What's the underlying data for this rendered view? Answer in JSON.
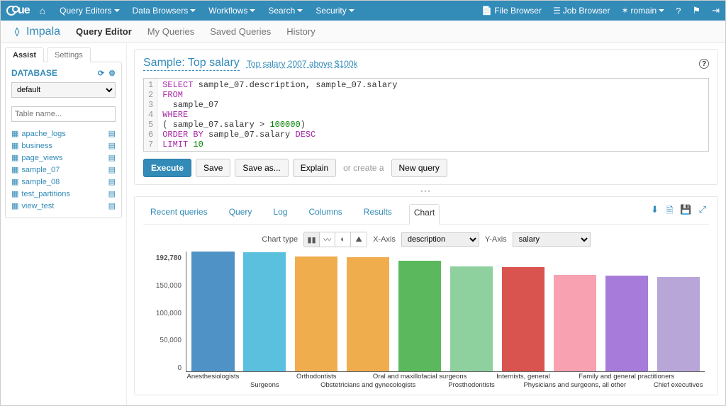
{
  "topnav": {
    "menus": [
      "Query Editors",
      "Data Browsers",
      "Workflows",
      "Search",
      "Security"
    ],
    "file_browser": "File Browser",
    "job_browser": "Job Browser",
    "user": "romain"
  },
  "subnav": {
    "brand": "Impala",
    "tabs": [
      "Query Editor",
      "My Queries",
      "Saved Queries",
      "History"
    ],
    "active": 0
  },
  "assist": {
    "tabs": [
      "Assist",
      "Settings"
    ],
    "active": 0,
    "db_label": "DATABASE",
    "db_selected": "default",
    "filter_placeholder": "Table name...",
    "tables": [
      "apache_logs",
      "business",
      "page_views",
      "sample_07",
      "sample_08",
      "test_partitions",
      "view_test"
    ]
  },
  "query": {
    "title": "Sample: Top salary",
    "subtitle": "Top salary 2007 above $100k",
    "sql_lines": [
      {
        "n": 1,
        "html": "<span class='kw'>SELECT</span> sample_07.description, sample_07.salary"
      },
      {
        "n": 2,
        "html": "<span class='kw'>FROM</span>"
      },
      {
        "n": 3,
        "html": "  sample_07"
      },
      {
        "n": 4,
        "html": "<span class='kw'>WHERE</span>"
      },
      {
        "n": 5,
        "html": "( sample_07.salary <span class='op'>&gt;</span> <span class='num'>100000</span>)"
      },
      {
        "n": 6,
        "html": "<span class='kw'>ORDER BY</span> sample_07.salary <span class='kw'>DESC</span>"
      },
      {
        "n": 7,
        "html": "<span class='kw'>LIMIT</span> <span class='num'>10</span>"
      }
    ],
    "buttons": {
      "execute": "Execute",
      "save": "Save",
      "saveas": "Save as...",
      "explain": "Explain",
      "or": "or create a",
      "newq": "New query"
    }
  },
  "results": {
    "tabs": [
      "Recent queries",
      "Query",
      "Log",
      "Columns",
      "Results",
      "Chart"
    ],
    "active": 5,
    "chart_type_label": "Chart type",
    "xaxis_label": "X-Axis",
    "xaxis_value": "description",
    "yaxis_label": "Y-Axis",
    "yaxis_value": "salary"
  },
  "chart_data": {
    "type": "bar",
    "xlabel": "description",
    "ylabel": "salary",
    "ylim": [
      0,
      192780
    ],
    "y_ticks": [
      "192,780",
      "150,000",
      "100,000",
      "50,000",
      "0"
    ],
    "categories": [
      "Anesthesiologists",
      "Surgeons",
      "Orthodontists",
      "Obstetricians and gynecologists",
      "Oral and maxillofacial surgeons",
      "Prosthodontists",
      "Internists, general",
      "Physicians and surgeons, all other",
      "Family and general practitioners",
      "Chief executives"
    ],
    "values": [
      192780,
      191410,
      185340,
      183600,
      178440,
      169360,
      167270,
      155150,
      153640,
      151370
    ],
    "colors": [
      "#4f93c6",
      "#5bc0de",
      "#f0ad4e",
      "#f0ad4e",
      "#5cb85c",
      "#8fd19e",
      "#d9534f",
      "#f7a1b1",
      "#a77bd9",
      "#b8a6d9"
    ],
    "label_row": [
      0,
      1,
      0,
      1,
      0,
      1,
      0,
      1,
      0,
      1
    ]
  }
}
